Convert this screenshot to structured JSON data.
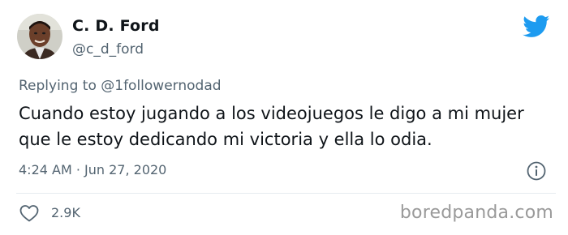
{
  "author": {
    "name": "C. D. Ford",
    "handle": "@c_d_ford"
  },
  "reply": {
    "prefix": "Replying to ",
    "target": "@1followernodad"
  },
  "tweet": {
    "text": "Cuando estoy jugando a los videojuegos le digo a mi mujer que le estoy dedicando mi victoria y ella lo odia.",
    "timestamp": "4:24 AM · Jun 27, 2020"
  },
  "engagement": {
    "likes": "2.9K"
  },
  "watermark": "boredpanda.com",
  "icons": {
    "brand": "twitter-bird-icon",
    "info": "info-icon",
    "like": "heart-icon"
  },
  "colors": {
    "twitter_blue": "#1d9bf0",
    "text_primary": "#0f1419",
    "text_secondary": "#536471",
    "divider": "#e6ecf0"
  }
}
